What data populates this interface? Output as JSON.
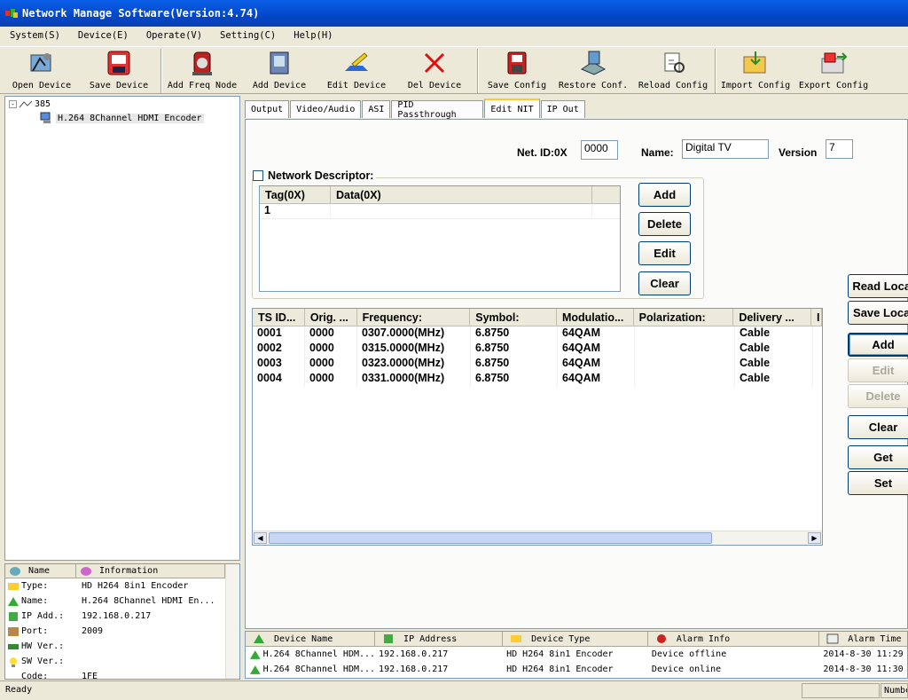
{
  "window": {
    "title": "Network Manage Software(Version:4.74)"
  },
  "menu": [
    "System(S)",
    "Device(E)",
    "Operate(V)",
    "Setting(C)",
    "Help(H)"
  ],
  "toolbar": {
    "open_device": "Open Device",
    "save_device": "Save Device",
    "add_freq_node": "Add Freq Node",
    "add_device": "Add Device",
    "edit_device": "Edit Device",
    "del_device": "Del Device",
    "save_config": "Save Config",
    "restore_conf": "Restore Conf.",
    "reload_config": "Reload Config",
    "import_config": "Import Config",
    "export_config": "Export Config"
  },
  "tree": {
    "root": "385",
    "child": "H.264 8Channel HDMI Encoder"
  },
  "info": {
    "headers": [
      "Name",
      "Information"
    ],
    "rows": [
      {
        "key": "Type:",
        "value": "HD H264 8in1 Encoder"
      },
      {
        "key": "Name:",
        "value": "H.264 8Channel HDMI En..."
      },
      {
        "key": "IP Add.:",
        "value": "192.168.0.217"
      },
      {
        "key": "Port:",
        "value": "2009"
      },
      {
        "key": "HW Ver.:",
        "value": ""
      },
      {
        "key": "SW Ver.:",
        "value": ""
      },
      {
        "key": "Code:",
        "value": "1FE"
      }
    ]
  },
  "tabs": [
    "Output",
    "Video/Audio",
    "ASI",
    "PID Passthrough",
    "Edit NIT",
    "IP Out"
  ],
  "nit": {
    "net_id_label": "Net. ID:0X",
    "net_id": "0000",
    "name_label": "Name:",
    "name": "Digital TV",
    "version_label": "Version",
    "version": "7",
    "network_descriptor_label": "Network Descriptor:",
    "desc_headers": [
      "Tag(0X)",
      "Data(0X)"
    ],
    "desc_rows": [
      {
        "tag": "1",
        "data": ""
      }
    ],
    "desc_buttons": {
      "add": "Add",
      "delete": "Delete",
      "edit": "Edit",
      "clear": "Clear"
    },
    "ts_headers": [
      "TS ID...",
      "Orig. ...",
      "Frequency:",
      "Symbol:",
      "Modulatio...",
      "Polarization:",
      "Delivery ...",
      "I"
    ],
    "ts_rows": [
      [
        "0001",
        "0000",
        "0307.0000(MHz)",
        "6.8750",
        "64QAM",
        "",
        "Cable"
      ],
      [
        "0002",
        "0000",
        "0315.0000(MHz)",
        "6.8750",
        "64QAM",
        "",
        "Cable"
      ],
      [
        "0003",
        "0000",
        "0323.0000(MHz)",
        "6.8750",
        "64QAM",
        "",
        "Cable"
      ],
      [
        "0004",
        "0000",
        "0331.0000(MHz)",
        "6.8750",
        "64QAM",
        "",
        "Cable"
      ]
    ],
    "side_buttons": {
      "read_local": "Read Local",
      "save_local": "Save Local",
      "add": "Add",
      "edit": "Edit",
      "delete": "Delete",
      "clear": "Clear",
      "get": "Get",
      "set": "Set"
    }
  },
  "alarm": {
    "headers": [
      "Device Name",
      "IP Address",
      "Device Type",
      "Alarm Info",
      "Alarm Time"
    ],
    "rows": [
      {
        "name": "H.264 8Channel HDM...",
        "ip": "192.168.0.217",
        "type": "HD H264 8in1 Encoder",
        "info": "Device offline",
        "time": "2014-8-30 11:29"
      },
      {
        "name": "H.264 8Channel HDM...",
        "ip": "192.168.0.217",
        "type": "HD H264 8in1 Encoder",
        "info": "Device online",
        "time": "2014-8-30 11:30"
      }
    ]
  },
  "status": {
    "ready": "Ready",
    "numbers": "Numbe"
  }
}
